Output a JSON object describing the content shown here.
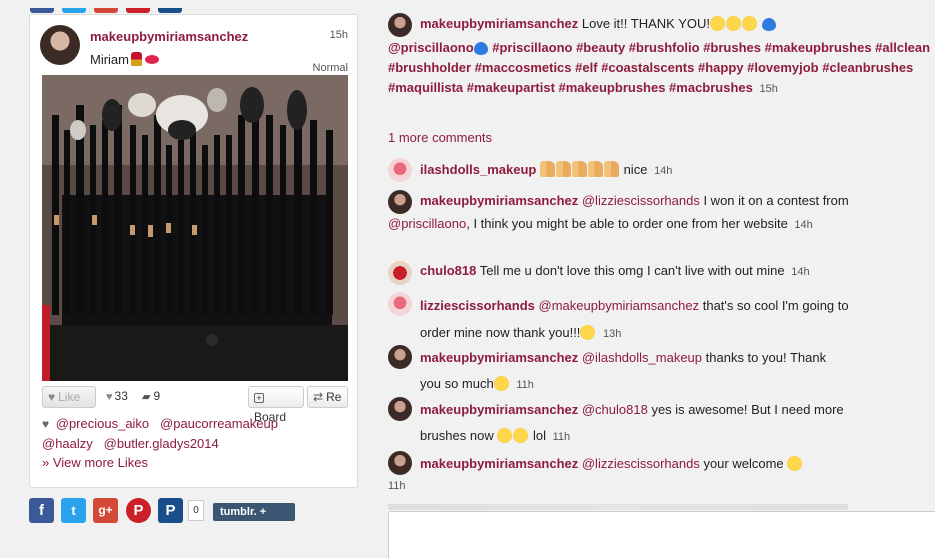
{
  "post": {
    "username": "makeupbymiriamsanchez",
    "time": "15h",
    "caption": "Miriam",
    "filter": "Normal",
    "likes_count": "33",
    "comments_count": "9",
    "like_label": "Like",
    "board_label": "Board",
    "repost_label": "Re",
    "likers": [
      "@precious_aiko",
      "@paucorreamakeup",
      "@haalzy",
      "@butler.gladys2014"
    ],
    "view_more_likes": "» View more Likes"
  },
  "share": {
    "buttons": [
      {
        "icon": "facebook-icon",
        "glyph": "f",
        "color": "#3b5998"
      },
      {
        "icon": "twitter-icon",
        "glyph": "t",
        "color": "#2aa3ef"
      },
      {
        "icon": "googleplus-icon",
        "glyph": "g+",
        "color": "#d34836"
      },
      {
        "icon": "pinterest-icon",
        "glyph": "P",
        "color": "#cb2027"
      },
      {
        "icon": "pinboard-icon",
        "glyph": "P",
        "color": "#1a4e8a"
      }
    ],
    "count": "0",
    "tumblr_label": "tumblr. +"
  },
  "comments": {
    "first": {
      "user": "makeupbymiriamsanchez",
      "text": "Love it!! THANK YOU!",
      "mention": "@priscillaono",
      "tags": "#priscillaono #beauty #brushfolio #brushes #makeupbrushes #allclean #brushholder #maccosmetics #elf #coastalscents #happy #lovemyjob #cleanbrushes #maquillista #makeupartist #makeupbrushes #macbrushes",
      "time": "15h"
    },
    "more_comments": "1 more comments",
    "items": [
      {
        "user": "ilashdolls_makeup",
        "mention": "",
        "text": "nice",
        "time": "14h"
      },
      {
        "user": "makeupbymiriamsanchez",
        "mention": "@lizziescissorhands",
        "text": "I won it on a contest from",
        "mention2": "@priscillaono",
        "text2": ", I think you might be able to order one from her website",
        "time": "14h"
      },
      {
        "user": "chulo818",
        "mention": "",
        "text": "Tell me u don't love this omg I can't live with out mine",
        "time": "14h"
      },
      {
        "user": "lizziescissorhands",
        "mention": "@makeupbymiriamsanchez",
        "text": "that's so cool I'm going to order mine now thank you!!!",
        "time": "13h"
      },
      {
        "user": "makeupbymiriamsanchez",
        "mention": "@ilashdolls_makeup",
        "text": "thanks to you! Thank you so much",
        "time": "11h"
      },
      {
        "user": "makeupbymiriamsanchez",
        "mention": "@chulo818",
        "text": "yes is awesome! But I need more brushes now",
        "text2": "lol",
        "time": "11h"
      },
      {
        "user": "makeupbymiriamsanchez",
        "mention": "@lizziescissorhands",
        "text": "your welcome",
        "time": "11h"
      }
    ]
  }
}
